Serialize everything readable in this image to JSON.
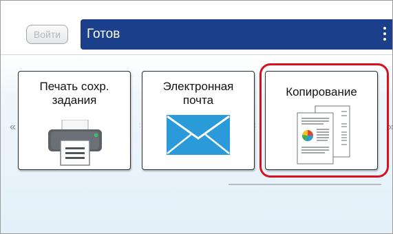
{
  "header": {
    "login_label": "Войти",
    "status": "Готов"
  },
  "tiles": [
    {
      "label": "Печать сохр.\nзадания",
      "icon": "printer-icon"
    },
    {
      "label": "Электронная\nпочта",
      "icon": "envelope-icon"
    },
    {
      "label": "Копирование",
      "icon": "copy-documents-icon"
    }
  ],
  "nav": {
    "prev_arrow": "«",
    "next_arrow": "»"
  },
  "colors": {
    "status_bar": "#1b3f8b",
    "highlight": "#d90f1e",
    "envelope": "#2a9bd8"
  }
}
